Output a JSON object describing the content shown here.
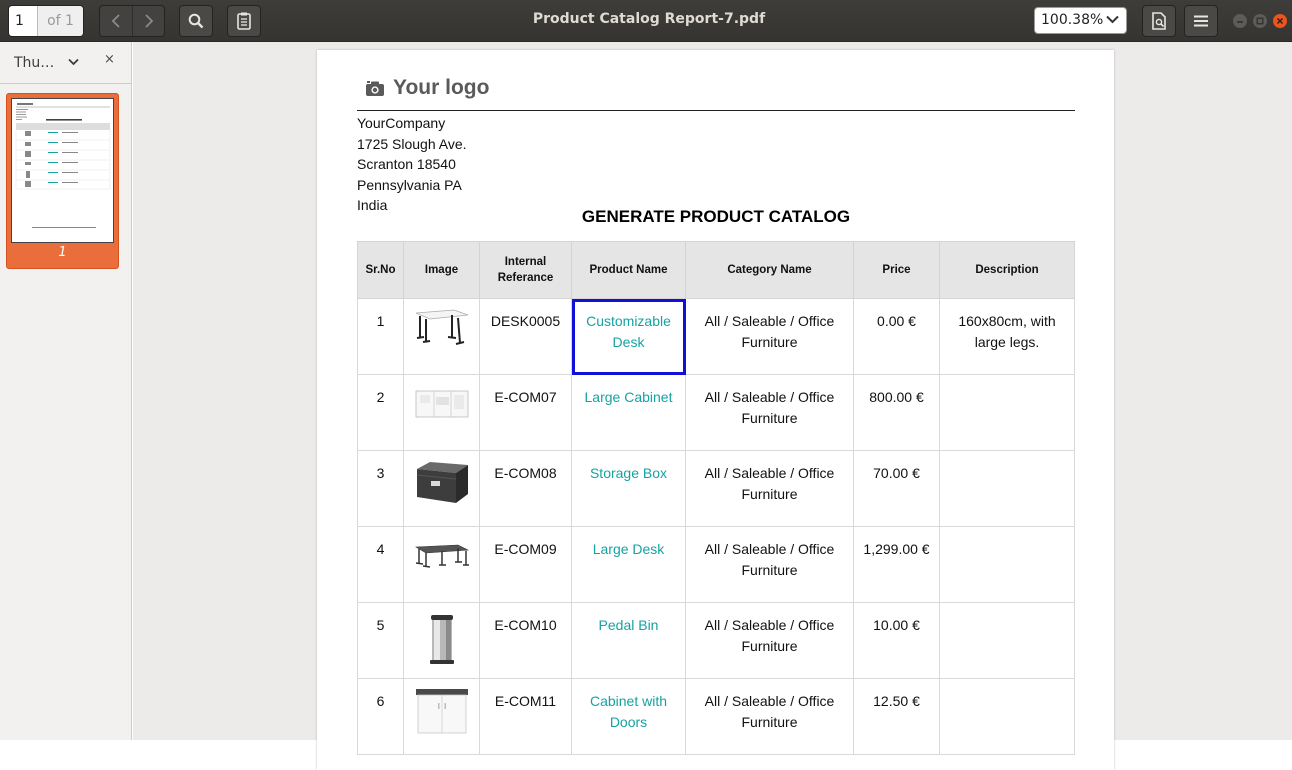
{
  "toolbar": {
    "page_number": "1",
    "page_of": "of 1",
    "title": "Product Catalog Report-7.pdf",
    "zoom": "100.38%"
  },
  "sidebar": {
    "label": "Thu…",
    "close": "×",
    "thumb_page_number": "1"
  },
  "document": {
    "logo_text": "Your logo",
    "address": [
      "YourCompany",
      "1725 Slough Ave.",
      "Scranton 18540",
      "Pennsylvania PA",
      "India"
    ],
    "title": "GENERATE PRODUCT CATALOG",
    "headers": [
      "Sr.No",
      "Image",
      "Internal Referance",
      "Product Name",
      "Category Name",
      "Price",
      "Description"
    ],
    "rows": [
      {
        "sr": "1",
        "ref": "DESK0005",
        "name": "Customizable Desk",
        "category": "All / Saleable / Office Furniture",
        "price": "0.00 €",
        "description": "160x80cm, with large legs.",
        "image": "desk-icon"
      },
      {
        "sr": "2",
        "ref": "E-COM07",
        "name": "Large Cabinet",
        "category": "All / Saleable / Office Furniture",
        "price": "800.00 €",
        "description": "",
        "image": "cabinet-icon"
      },
      {
        "sr": "3",
        "ref": "E-COM08",
        "name": "Storage Box",
        "category": "All / Saleable / Office Furniture",
        "price": "70.00 €",
        "description": "",
        "image": "storage-box-icon"
      },
      {
        "sr": "4",
        "ref": "E-COM09",
        "name": "Large Desk",
        "category": "All / Saleable / Office Furniture",
        "price": "1,299.00 €",
        "description": "",
        "image": "large-desk-icon"
      },
      {
        "sr": "5",
        "ref": "E-COM10",
        "name": "Pedal Bin",
        "category": "All / Saleable / Office Furniture",
        "price": "10.00 €",
        "description": "",
        "image": "pedal-bin-icon"
      },
      {
        "sr": "6",
        "ref": "E-COM11",
        "name": "Cabinet with Doors",
        "category": "All / Saleable / Office Furniture",
        "price": "12.50 €",
        "description": "",
        "image": "cabinet-doors-icon"
      }
    ]
  },
  "colors": {
    "accent": "#e96e3c",
    "link": "#17a2a2",
    "highlight": "#1010d8"
  }
}
